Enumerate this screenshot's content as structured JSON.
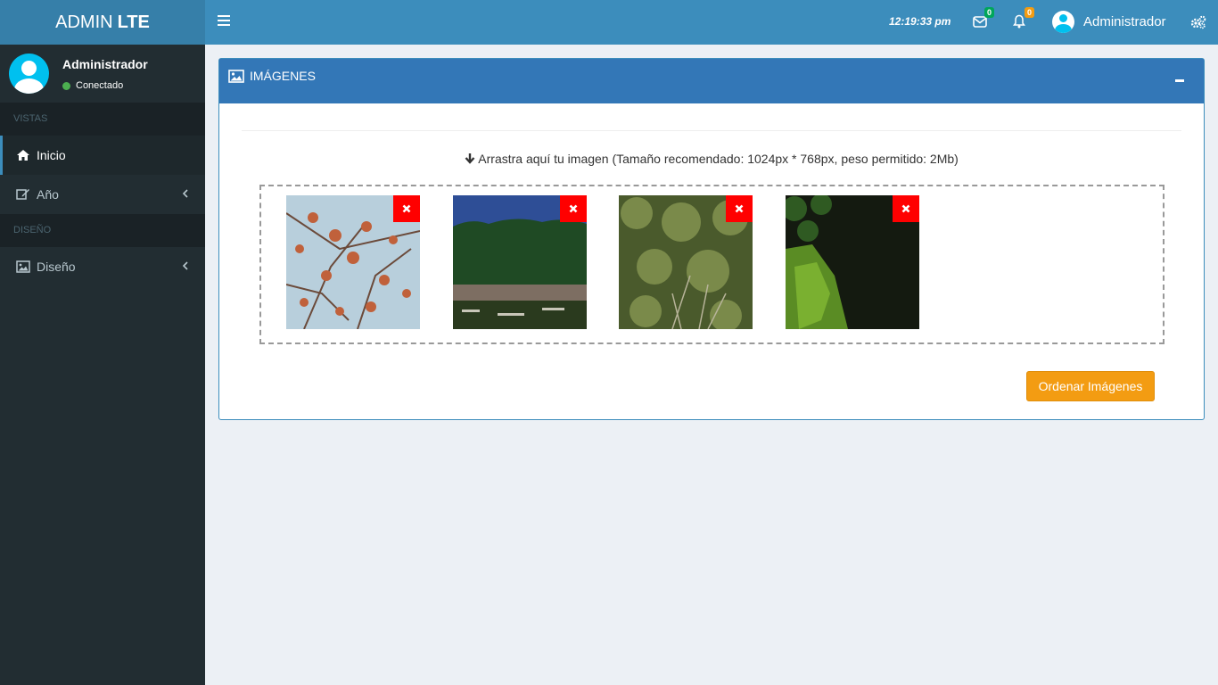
{
  "header": {
    "logo_light": "ADMIN",
    "logo_bold": "LTE",
    "clock": "12:19:33 pm",
    "mail_count": "0",
    "notifications_count": "0",
    "user_name": "Administrador",
    "colors": {
      "brand": "#367fa9",
      "navbar": "#3c8dbc"
    }
  },
  "sidebar": {
    "user_name": "Administrador",
    "user_status": "Conectado",
    "sections": [
      {
        "label": "VISTAS",
        "items": [
          {
            "label": "Inicio",
            "icon": "home-icon"
          },
          {
            "label": "Año",
            "icon": "edit-icon"
          }
        ]
      },
      {
        "label": "DISEÑO",
        "items": [
          {
            "label": "Diseño",
            "icon": "image-icon"
          }
        ]
      }
    ]
  },
  "panel": {
    "title": "IMÁGENES",
    "drop_hint": "Arrastra aquí tu imagen (Tamaño recomendado: 1024px * 768px, peso permitido: 2Mb)",
    "order_button": "Ordenar Imágenes",
    "images": [
      {
        "name": "autumn-branches-photo"
      },
      {
        "name": "river-forest-photo"
      },
      {
        "name": "bushes-photo"
      },
      {
        "name": "mossy-rock-photo"
      }
    ]
  }
}
